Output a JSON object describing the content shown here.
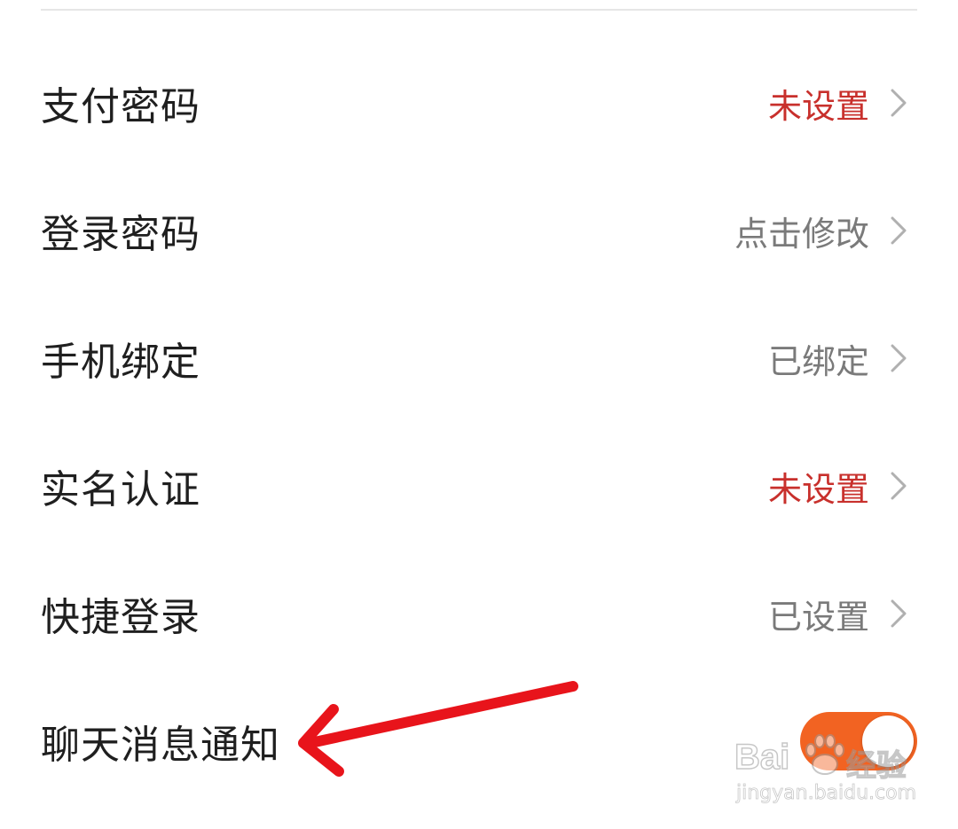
{
  "settings": {
    "rows": [
      {
        "label": "支付密码",
        "value": "未设置",
        "status": "warn"
      },
      {
        "label": "登录密码",
        "value": "点击修改",
        "status": "normal"
      },
      {
        "label": "手机绑定",
        "value": "已绑定",
        "status": "normal"
      },
      {
        "label": "实名认证",
        "value": "未设置",
        "status": "warn"
      },
      {
        "label": "快捷登录",
        "value": "已设置",
        "status": "normal"
      }
    ],
    "toggle_row": {
      "label": "聊天消息通知",
      "enabled": true
    }
  },
  "watermark": {
    "brand": "Bai",
    "product": "经验",
    "url": "jingyan.baidu.com"
  },
  "colors": {
    "warn_text": "#c8302c",
    "normal_value_text": "#7a7a7a",
    "toggle_on": "#f26322",
    "annotation_arrow": "#e8141b"
  },
  "icons": {
    "row_chevron": "chevron-right-icon",
    "annotation": "arrow-left-icon"
  }
}
